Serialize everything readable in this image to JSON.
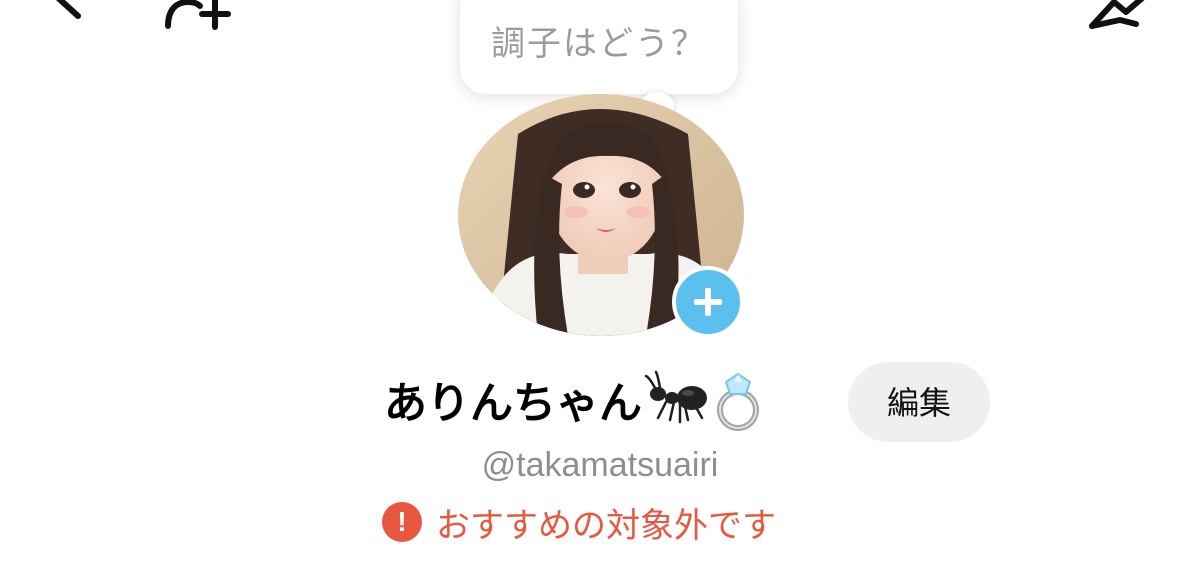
{
  "status": {
    "placeholder": "調子はどう？"
  },
  "profile": {
    "display_name": "ありんちゃん",
    "name_emojis": [
      "ant",
      "ring"
    ],
    "user_id": "@takamatsuairi",
    "edit_label": "編集"
  },
  "warning": {
    "text": "おすすめの対象外です",
    "icon_text": "!"
  },
  "icons": {
    "back": "chevron-left-icon",
    "add_friend": "add-friend-icon",
    "share": "share-icon",
    "avatar_add": "plus-icon"
  },
  "colors": {
    "accent_blue": "#5bc0ee",
    "warning_red": "#e8573f",
    "muted_text": "#8e8e8e",
    "button_bg": "#efefef"
  }
}
